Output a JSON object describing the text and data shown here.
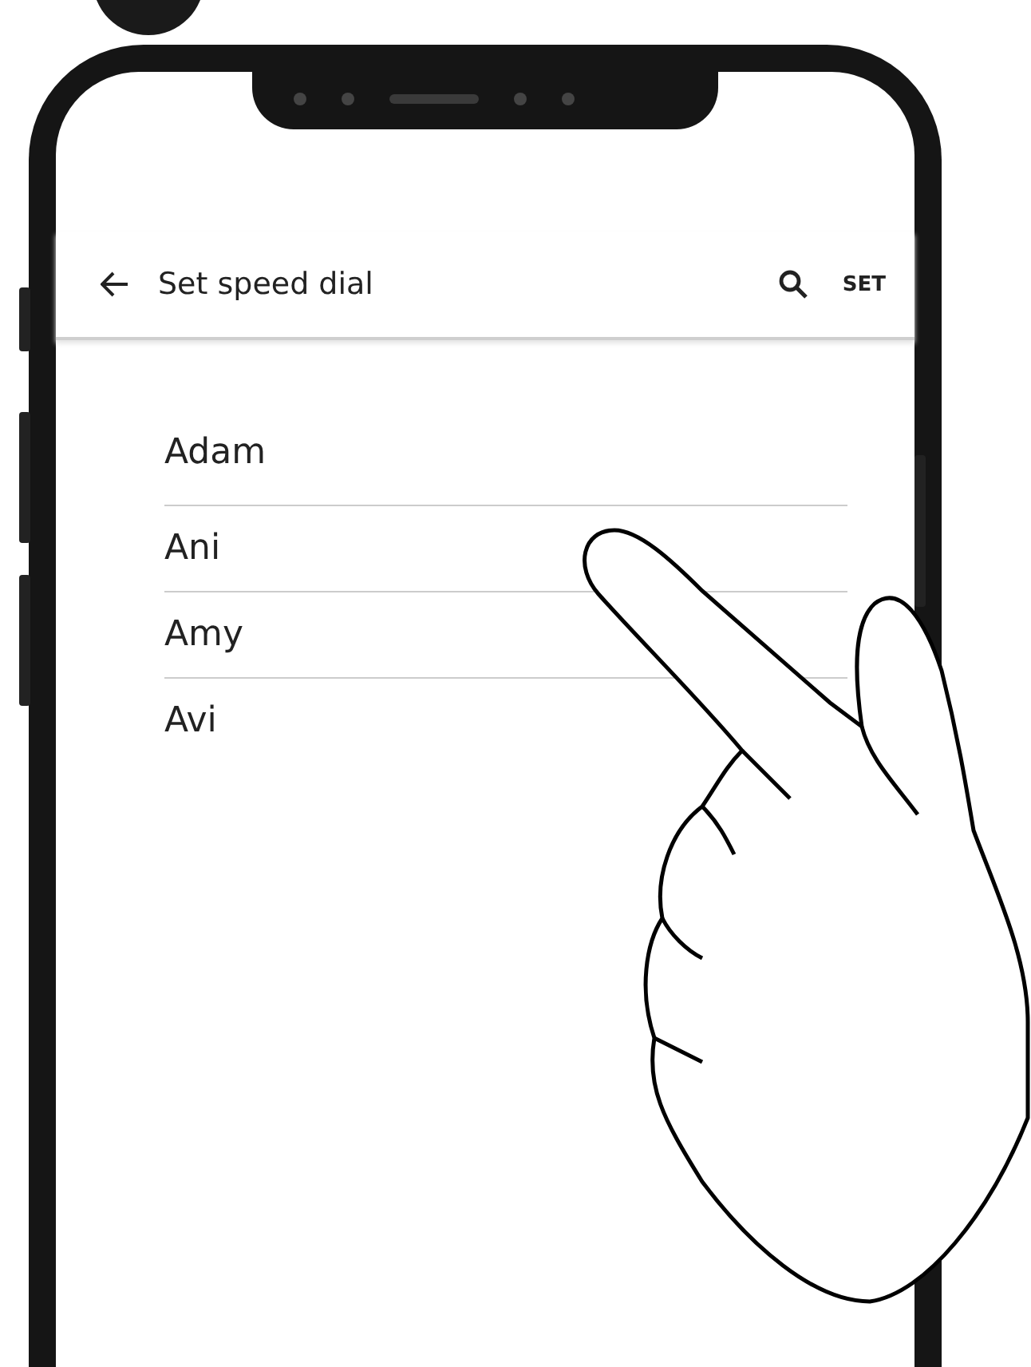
{
  "app_bar": {
    "title": "Set speed dial",
    "action": "SET"
  },
  "contacts": [
    {
      "name": "Adam"
    },
    {
      "name": "Ani"
    },
    {
      "name": "Amy"
    },
    {
      "name": "Avi"
    }
  ]
}
